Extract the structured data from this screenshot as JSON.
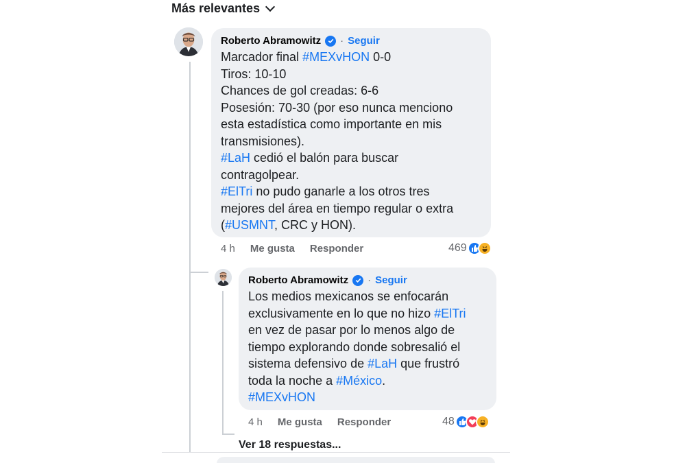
{
  "sort": {
    "label": "Más relevantes",
    "icon": "chevron-down-icon"
  },
  "comments": [
    {
      "author": "Roberto Abramowitz",
      "verified": true,
      "separator": "·",
      "follow_label": "Seguir",
      "lines": [
        [
          {
            "t": "Marcador final "
          },
          {
            "t": "#MEXvHON",
            "tag": true
          },
          {
            "t": " 0-0"
          }
        ],
        [
          {
            "t": "Tiros: 10-10"
          }
        ],
        [
          {
            "t": "Chances de gol creadas: 6-6"
          }
        ],
        [
          {
            "t": "Posesión: 70-30 (por eso nunca menciono"
          }
        ],
        [
          {
            "t": "esta estadística como importante en mis"
          }
        ],
        [
          {
            "t": "transmisiones)."
          }
        ],
        [
          {
            "t": "#LaH",
            "tag": true
          },
          {
            "t": " cedió el balón para buscar"
          }
        ],
        [
          {
            "t": "contragolpear."
          }
        ],
        [
          {
            "t": "#ElTri",
            "tag": true
          },
          {
            "t": " no pudo ganarle a los otros tres"
          }
        ],
        [
          {
            "t": "mejores del área en tiempo regular o extra"
          }
        ],
        [
          {
            "t": "("
          },
          {
            "t": "#USMNT",
            "tag": true
          },
          {
            "t": ", CRC y HON)."
          }
        ]
      ],
      "time": "4 h",
      "like_label": "Me gusta",
      "reply_label": "Responder",
      "reaction_count": "469",
      "reactions": [
        "like",
        "haha"
      ]
    },
    {
      "author": "Roberto Abramowitz",
      "verified": true,
      "separator": "·",
      "follow_label": "Seguir",
      "lines": [
        [
          {
            "t": "Los medios mexicanos se enfocarán"
          }
        ],
        [
          {
            "t": "exclusivamente en lo que no hizo "
          },
          {
            "t": "#ElTri",
            "tag": true
          }
        ],
        [
          {
            "t": "en vez de pasar por lo menos algo de"
          }
        ],
        [
          {
            "t": "tiempo explorando donde sobresalió el"
          }
        ],
        [
          {
            "t": "sistema defensivo de "
          },
          {
            "t": "#LaH",
            "tag": true
          },
          {
            "t": " que frustró"
          }
        ],
        [
          {
            "t": "toda la noche a "
          },
          {
            "t": "#México",
            "tag": true
          },
          {
            "t": "."
          }
        ],
        [
          {
            "t": "#MEXvHON",
            "tag": true
          }
        ]
      ],
      "time": "4 h",
      "like_label": "Me gusta",
      "reply_label": "Responder",
      "reaction_count": "48",
      "reactions": [
        "like",
        "love",
        "haha"
      ]
    }
  ],
  "view_replies_label": "Ver 18 respuestas...",
  "colors": {
    "link": "#1877f2",
    "bubble": "#eef0f3",
    "meta": "#65676b"
  }
}
